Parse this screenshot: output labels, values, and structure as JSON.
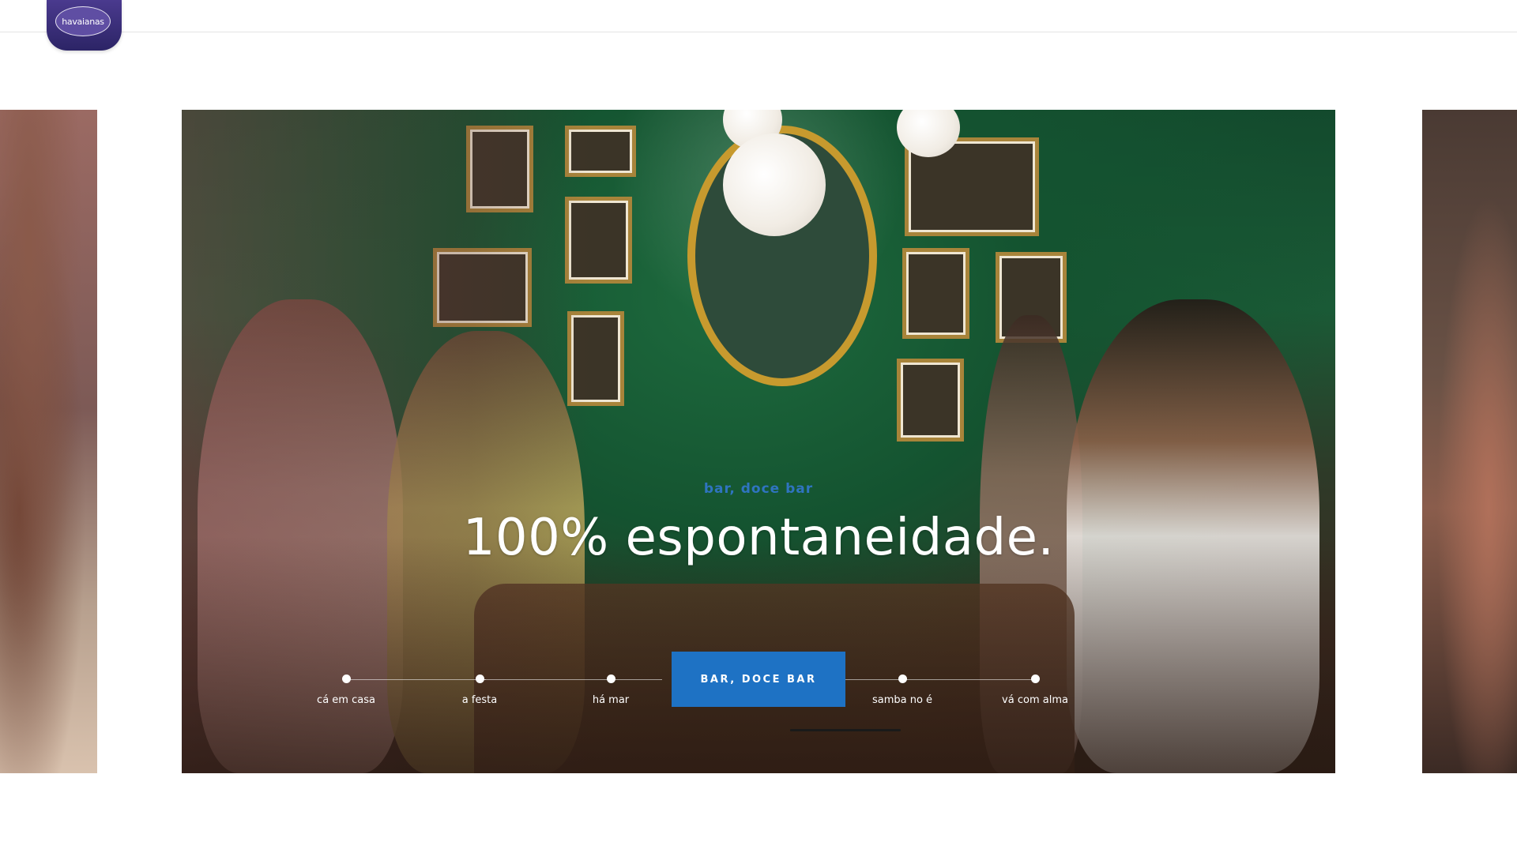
{
  "header": {
    "logo_text": "havaianas"
  },
  "hero": {
    "subtitle": "bar, doce bar",
    "title": "100% espontaneidade.",
    "active_button": "BAR, DOCE BAR",
    "progress": 1.0
  },
  "timeline": {
    "items": [
      {
        "label": "cá em casa"
      },
      {
        "label": "a festa"
      },
      {
        "label": "há mar"
      },
      {
        "label": "samba no é"
      },
      {
        "label": "vá com alma"
      }
    ]
  },
  "colors": {
    "brand_purple": "#3a2d7a",
    "accent_blue": "#1e72c4",
    "subtitle_blue": "#2f74c0"
  }
}
